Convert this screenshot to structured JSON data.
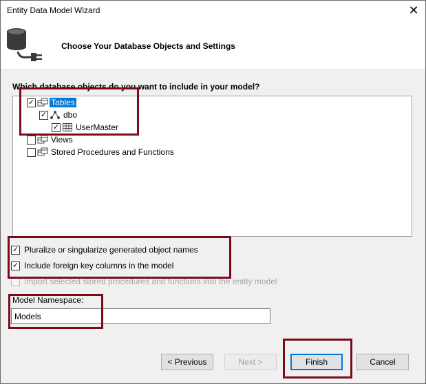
{
  "window": {
    "title": "Entity Data Model Wizard",
    "close_glyph": "✕"
  },
  "banner": {
    "heading": "Choose Your Database Objects and Settings",
    "icon": "database-plug-icon"
  },
  "question": "Which database objects do you want to include in your model?",
  "tree": {
    "tables_label": "Tables",
    "schema_label": "dbo",
    "table_label": "UserMaster",
    "views_label": "Views",
    "procs_label": "Stored Procedures and Functions",
    "check_glyph": "✓",
    "tables_checked": true,
    "schema_checked": true,
    "table_checked": true,
    "views_checked": false,
    "procs_checked": false
  },
  "options": {
    "pluralize_label": "Pluralize or singularize generated object names",
    "pluralize_checked": true,
    "foreign_keys_label": "Include foreign key columns in the model",
    "foreign_keys_checked": true,
    "import_procs_label": "Import selected stored procedures and functions into the entity model",
    "import_procs_checked": false
  },
  "namespace": {
    "label": "Model Namespace:",
    "value": "Models"
  },
  "buttons": {
    "previous": "< Previous",
    "next": "Next >",
    "finish": "Finish",
    "cancel": "Cancel"
  },
  "colors": {
    "highlight": "#7b0a1d",
    "selection": "#0078d7"
  }
}
